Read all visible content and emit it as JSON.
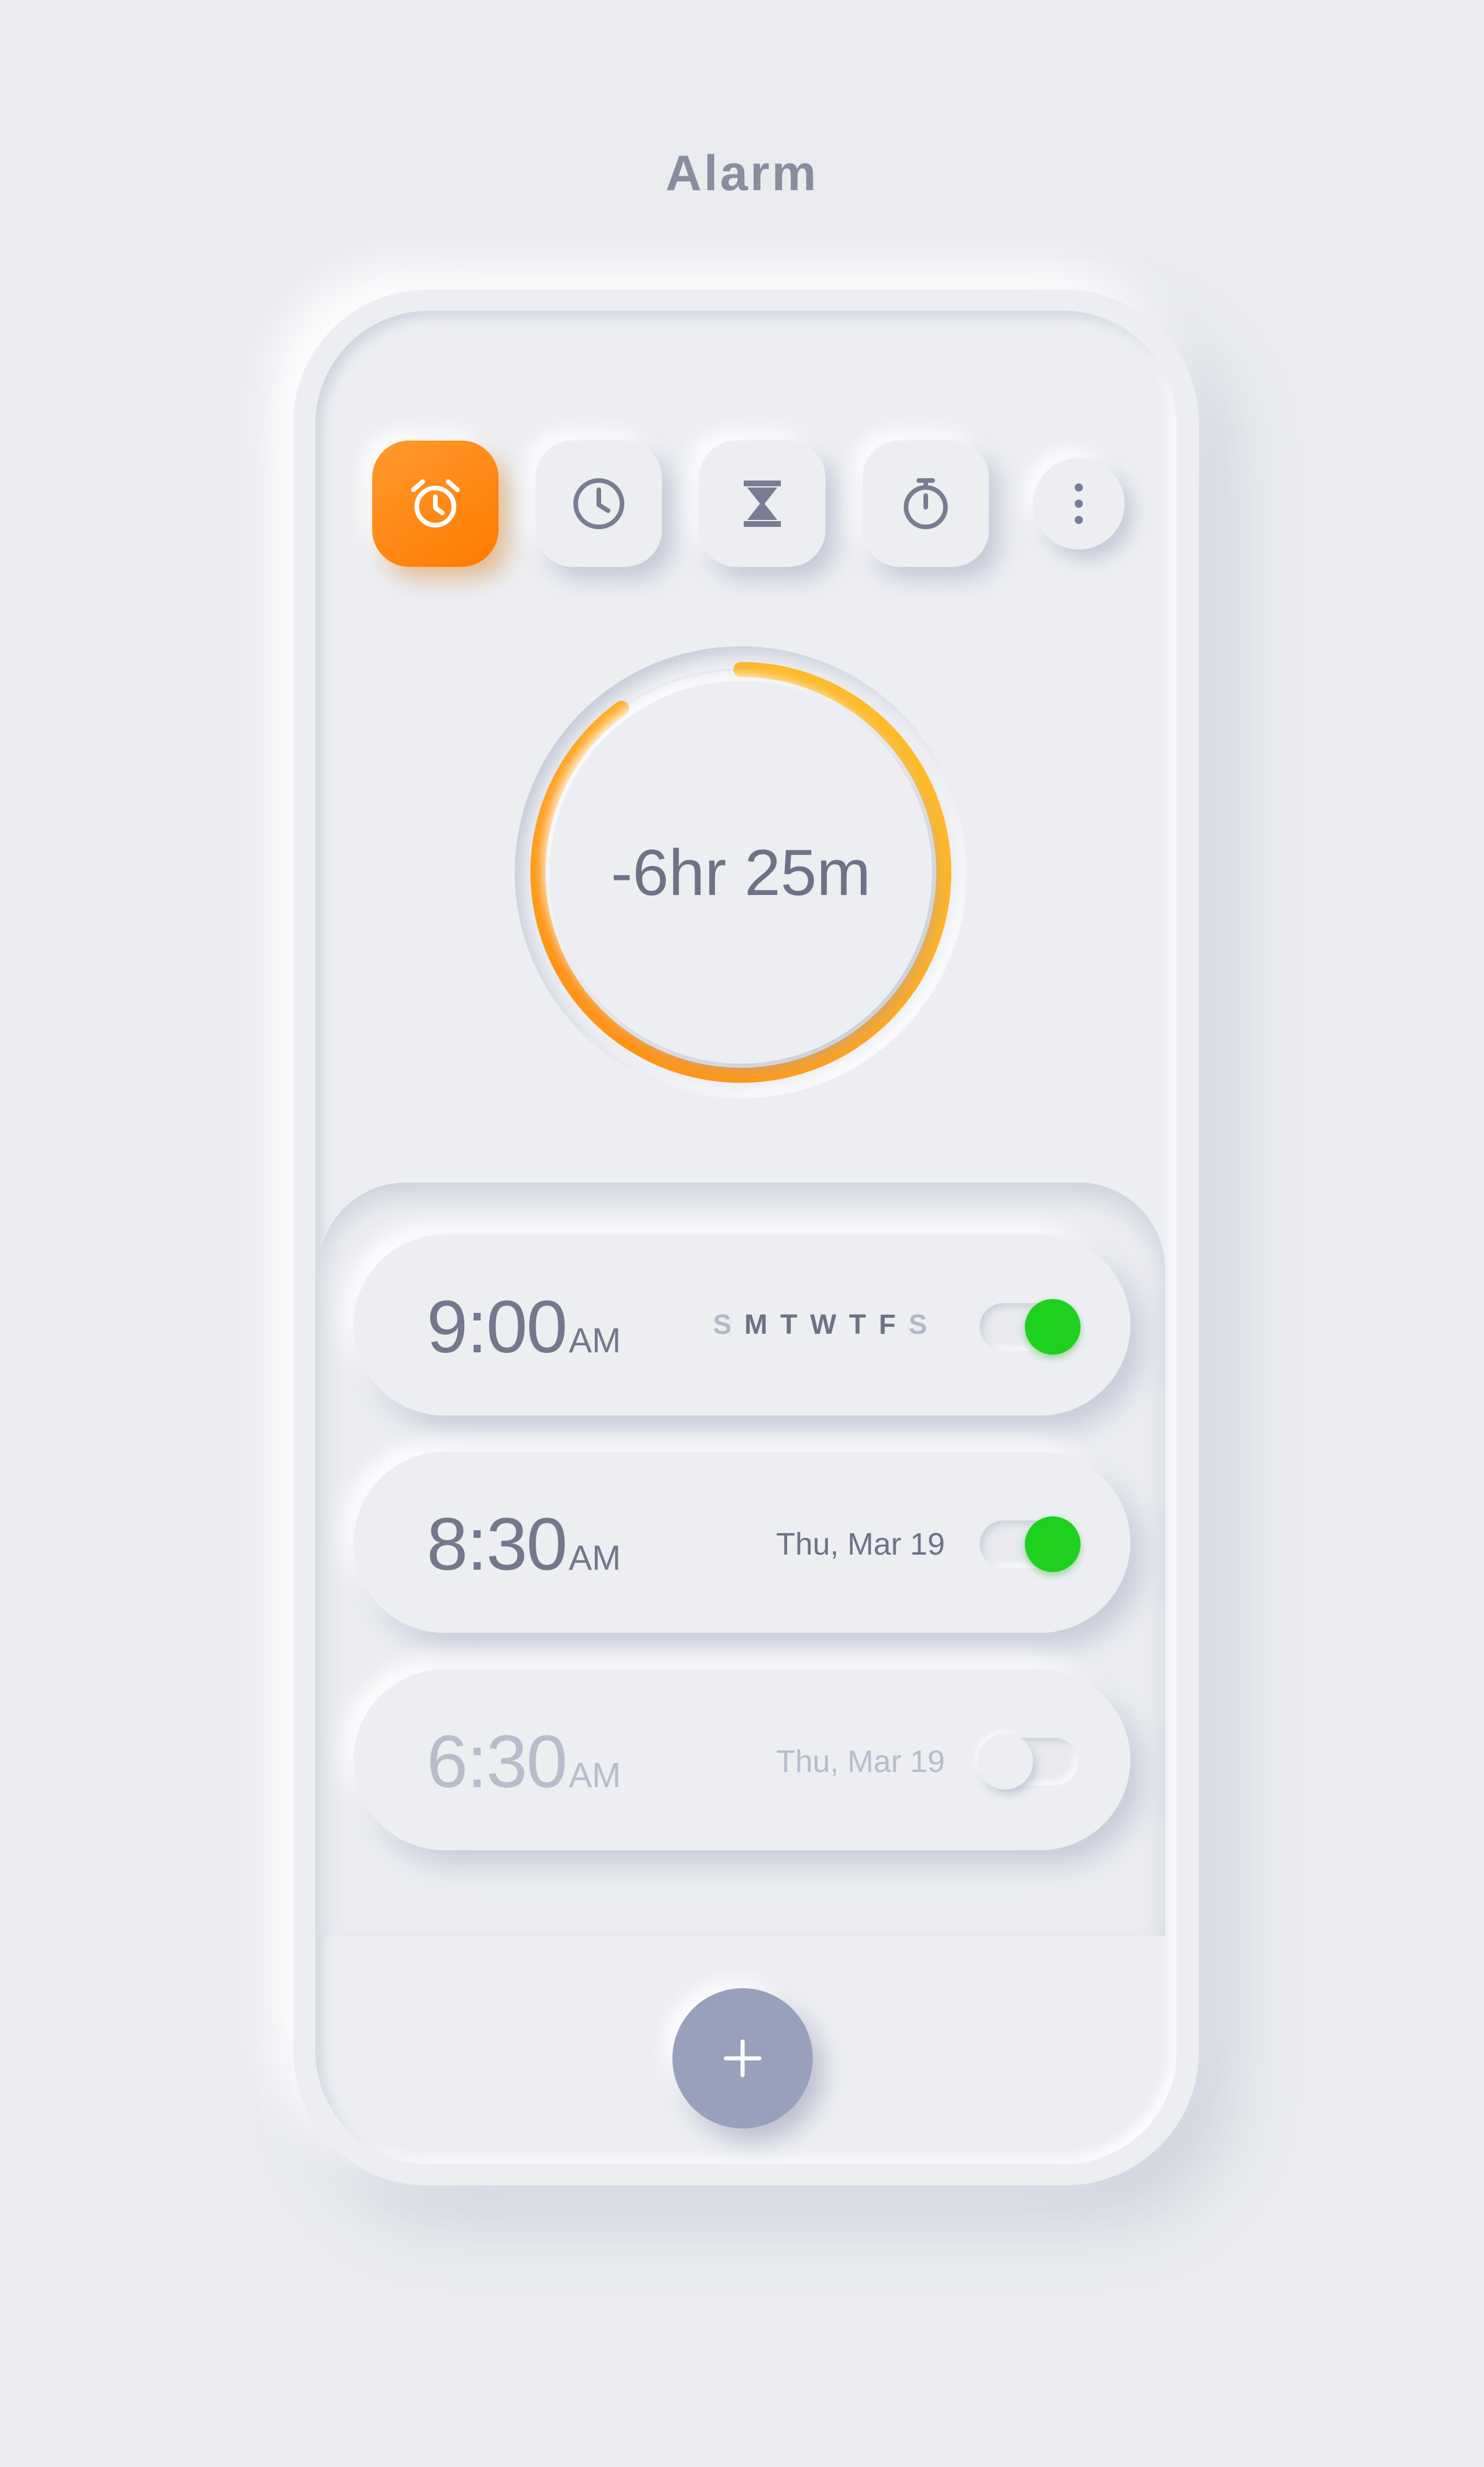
{
  "header": {
    "title": "Alarm"
  },
  "tabs": [
    {
      "name": "alarm",
      "icon": "alarm-clock-icon",
      "active": true
    },
    {
      "name": "clock",
      "icon": "clock-icon",
      "active": false
    },
    {
      "name": "timer",
      "icon": "hourglass-icon",
      "active": false
    },
    {
      "name": "stopwatch",
      "icon": "stopwatch-icon",
      "active": false
    },
    {
      "name": "more",
      "icon": "more-vertical-icon",
      "active": false
    }
  ],
  "countdown": {
    "label": "-6hr 25m",
    "progress": 0.9
  },
  "alarms": [
    {
      "time": "9:00",
      "period": "AM",
      "days": [
        "S",
        "M",
        "T",
        "W",
        "T",
        "F",
        "S"
      ],
      "days_active": [
        false,
        true,
        true,
        true,
        true,
        true,
        false
      ],
      "enabled": true
    },
    {
      "time": "8:30",
      "period": "AM",
      "date": "Thu, Mar 19",
      "enabled": true
    },
    {
      "time": "6:30",
      "period": "AM",
      "date": "Thu, Mar 19",
      "enabled": false
    }
  ],
  "fab": {
    "icon": "plus-icon"
  },
  "colors": {
    "background": "#e9ebef",
    "accent_orange": "#ff7a00",
    "ring_yellow": "#ffc12a",
    "toggle_on": "#1ed11e",
    "fab": "#99a0bb",
    "text": "#6f7287"
  }
}
